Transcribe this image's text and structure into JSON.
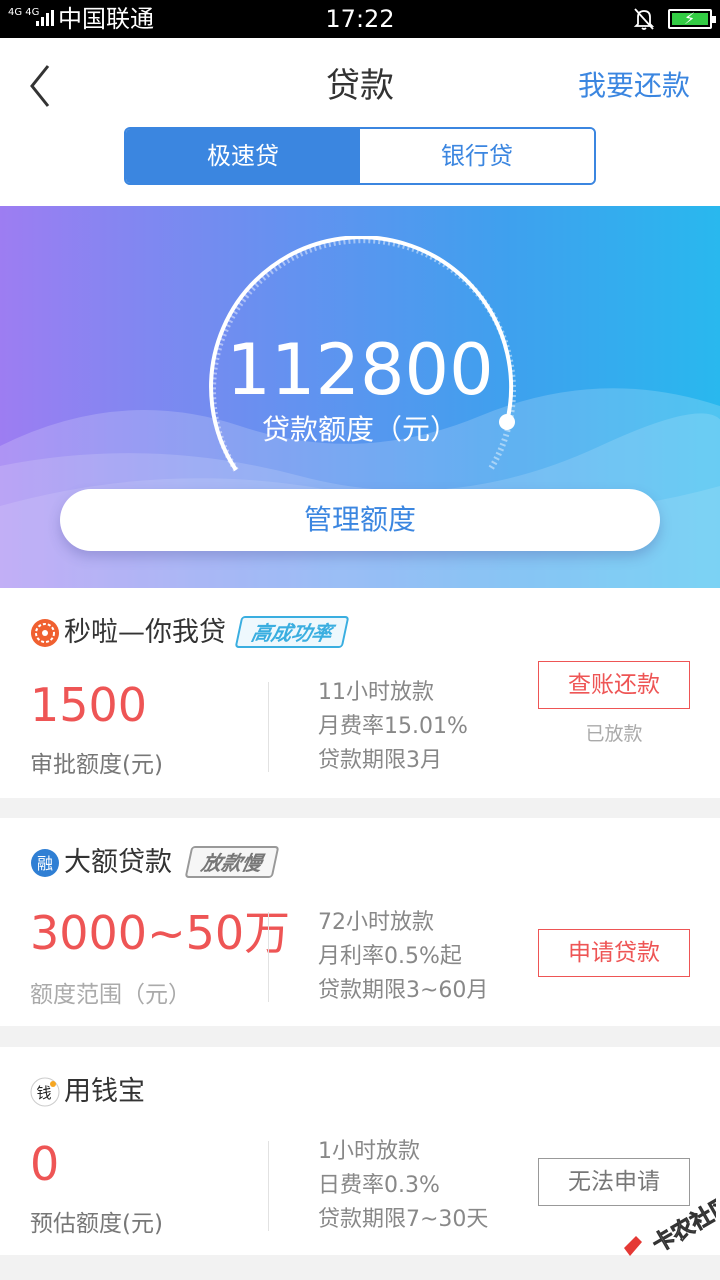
{
  "status_bar": {
    "network": "4G 4G",
    "carrier": "中国联通",
    "time": "17:22"
  },
  "header": {
    "title": "贷款",
    "repay_link": "我要还款",
    "tabs": [
      {
        "label": "极速贷",
        "active": true
      },
      {
        "label": "银行贷",
        "active": false
      }
    ]
  },
  "hero": {
    "credit_amount": "112800",
    "credit_label": "贷款额度（元）",
    "manage_button": "管理额度"
  },
  "loans": [
    {
      "name": "秒啦—你我贷",
      "tag": "高成功率",
      "amount": "1500",
      "amount_label": "审批额度(元)",
      "details": [
        "11小时放款",
        "月费率15.01%",
        "贷款期限3月"
      ],
      "action": "查账还款",
      "action_sub": "已放款"
    },
    {
      "name": "大额贷款",
      "tag": "放款慢",
      "amount": "3000~50万",
      "amount_label": "额度范围（元）",
      "details": [
        "72小时放款",
        "月利率0.5%起",
        "贷款期限3~60月"
      ],
      "action": "申请贷款"
    },
    {
      "name": "用钱宝",
      "amount": "0",
      "amount_label": "预估额度(元)",
      "details": [
        "1小时放款",
        "日费率0.3%",
        "贷款期限7~30天"
      ],
      "action": "无法申请"
    }
  ],
  "watermark": "卡农社区",
  "colors": {
    "accent": "#3b86e0",
    "amount_red": "#ee5555",
    "tag_blue": "#3aaee0",
    "tag_gray": "#777777"
  }
}
